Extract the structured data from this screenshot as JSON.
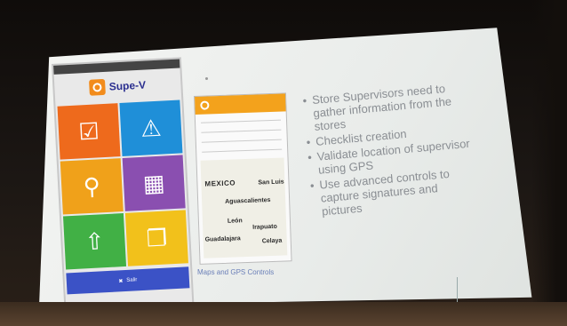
{
  "phone": {
    "brand": "Supe-V",
    "exit_label": "Salir"
  },
  "map": {
    "cities": [
      "MEXICO",
      "San Luis",
      "Aguascalientes",
      "León",
      "Irapuato",
      "Guadalajara",
      "Celaya"
    ]
  },
  "caption": "Maps and GPS Controls",
  "bullets": [
    "Store Supervisors need to gather information from the stores",
    "Checklist creation",
    "Validate location of supervisor using GPS",
    "Use advanced controls to capture signatures and pictures"
  ],
  "colors": {
    "orange": "#ee6a1c",
    "blue": "#1f8fd8",
    "amber": "#f0a11a",
    "purple": "#8a4fb0",
    "green": "#41b045",
    "yellow": "#f2c11b",
    "navy": "#3b52c6"
  },
  "icons": [
    "clipboard-check-icon",
    "warning-triangle-icon",
    "map-pin-icon",
    "calendar-icon",
    "upload-icon",
    "documents-icon",
    "tools-icon"
  ]
}
